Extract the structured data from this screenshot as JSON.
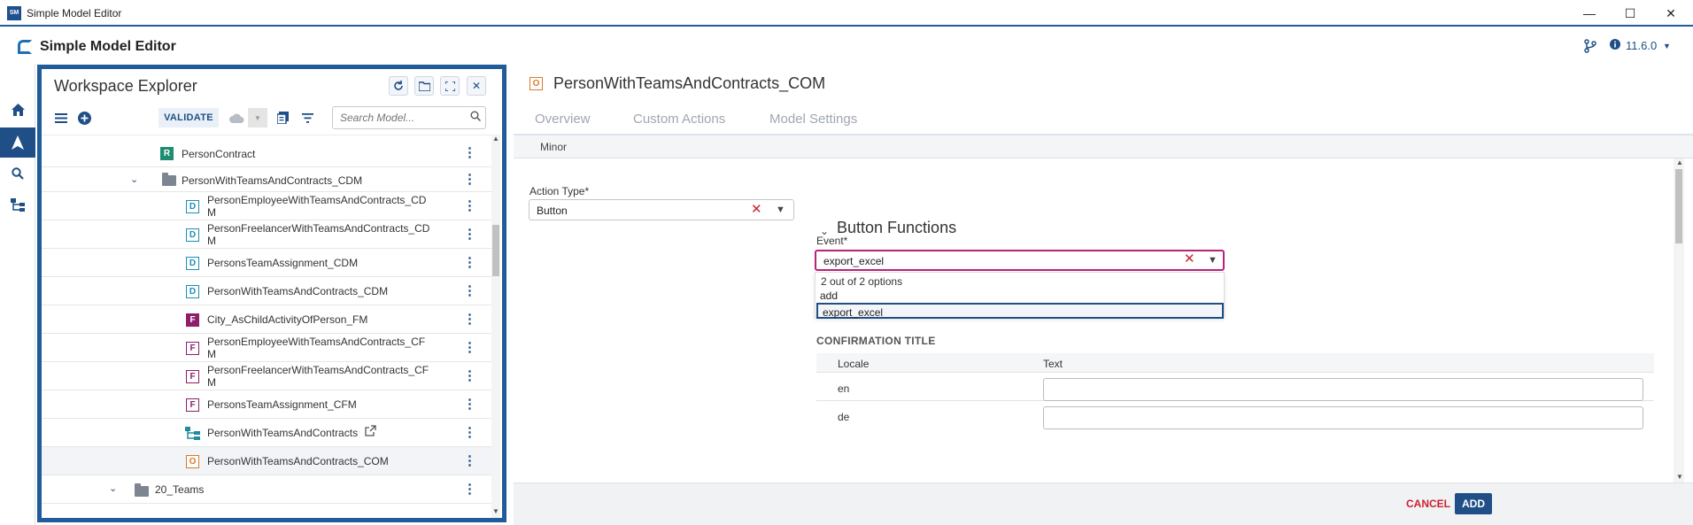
{
  "window": {
    "title": "Simple Model Editor",
    "minimize": "—",
    "maximize": "☐",
    "close": "✕"
  },
  "appbar": {
    "title": "Simple Model Editor",
    "version": "11.6.0"
  },
  "explorer": {
    "title": "Workspace Explorer",
    "validate_label": "VALIDATE",
    "search_placeholder": "Search Model...",
    "items": [
      {
        "label": "PersonContract",
        "type": "R"
      },
      {
        "label": "PersonWithTeamsAndContracts_CDM",
        "type": "folder"
      },
      {
        "label": "PersonEmployeeWithTeamsAndContracts_CD\nM",
        "type": "D"
      },
      {
        "label": "PersonFreelancerWithTeamsAndContracts_CD\nM",
        "type": "D"
      },
      {
        "label": "PersonsTeamAssignment_CDM",
        "type": "D"
      },
      {
        "label": "PersonWithTeamsAndContracts_CDM",
        "type": "D"
      },
      {
        "label": "City_AsChildActivityOfPerson_FM",
        "type": "F"
      },
      {
        "label": "PersonEmployeeWithTeamsAndContracts_CF\nM",
        "type": "F"
      },
      {
        "label": "PersonFreelancerWithTeamsAndContracts_CF\nM",
        "type": "F"
      },
      {
        "label": "PersonsTeamAssignment_CFM",
        "type": "F"
      },
      {
        "label": "PersonWithTeamsAndContracts",
        "type": "diagram"
      },
      {
        "label": "PersonWithTeamsAndContracts_COM",
        "type": "O"
      },
      {
        "label": "20_Teams",
        "type": "folder"
      }
    ]
  },
  "main": {
    "object_type": "O",
    "title": "PersonWithTeamsAndContracts_COM",
    "tabs": [
      "Overview",
      "Custom Actions",
      "Model Settings"
    ],
    "subbar": "Minor",
    "action_type_label": "Action Type*",
    "action_type_value": "Button",
    "section_title": "Button Functions",
    "event_label": "Event*",
    "event_value": "export_excel",
    "dropdown_count": "2 out of 2 options",
    "dropdown_options": [
      "add",
      "export_excel"
    ],
    "confirmation_title": "CONFIRMATION TITLE",
    "table_headers": [
      "Locale",
      "Text"
    ],
    "table_rows": [
      {
        "locale": "en"
      },
      {
        "locale": "de"
      }
    ],
    "cancel_label": "CANCEL",
    "add_label": "ADD"
  },
  "colors": {
    "brand": "#1f4f86",
    "frame": "#1f5c99",
    "danger": "#cc2233",
    "focus": "#b8237a"
  }
}
